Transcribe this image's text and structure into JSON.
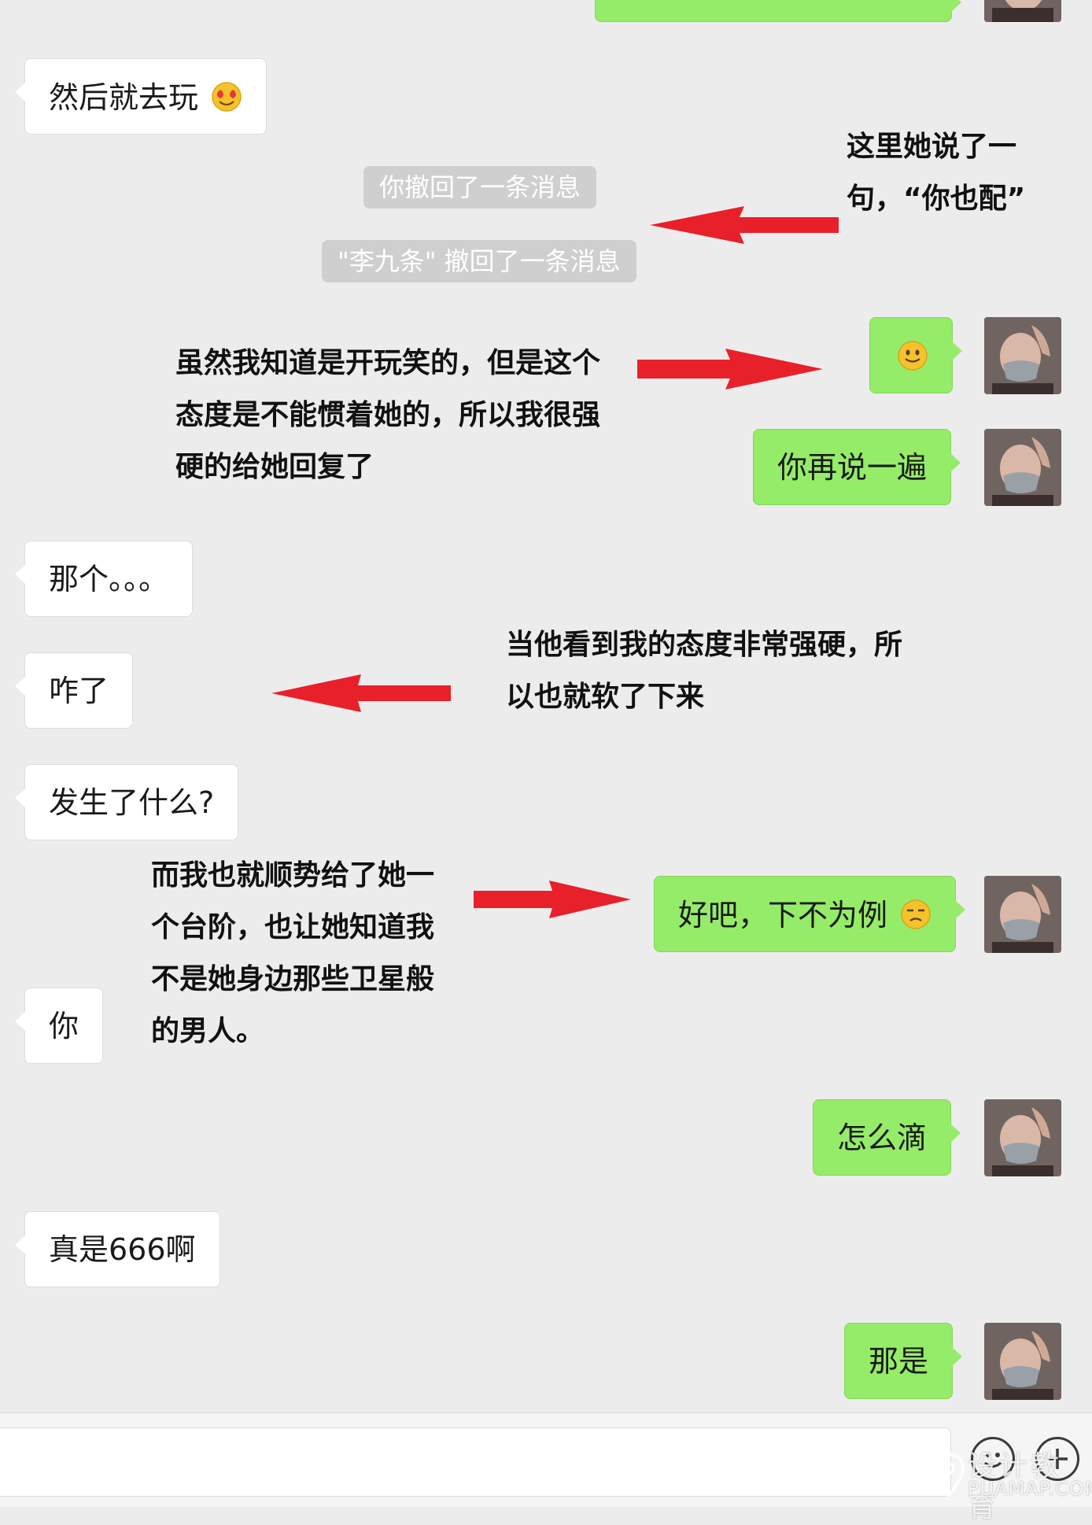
{
  "messages": {
    "out_top_partial": "",
    "in_1": "然后就去玩",
    "sys_1": "你撤回了一条消息",
    "sys_2": "\"李九条\" 撤回了一条消息",
    "out_1": "",
    "out_2": "你再说一遍",
    "in_2": "那个。。。",
    "in_3": "咋了",
    "in_4": "发生了什么?",
    "out_3": "好吧，下不为例",
    "in_5": "你",
    "out_4": "怎么滴",
    "in_6": "真是666啊",
    "out_5": "那是"
  },
  "notes": {
    "note_1": [
      "这里她说了一",
      "句，“你也配”"
    ],
    "note_2": [
      "虽然我知道是开玩笑的，但是这个",
      "态度是不能惯着她的，所以我很强",
      "硬的给她回复了"
    ],
    "note_3": [
      "当他看到我的态度非常强硬，所",
      "以也就软了下来"
    ],
    "note_4": [
      "而我也就顺势给了她一",
      "个台阶，也让她知道我",
      "不是她身边那些卫星般",
      "的男人。"
    ]
  },
  "watermark": {
    "name": "设计教育",
    "domain": "PUAMAP.COM"
  },
  "colors": {
    "background": "#ececec",
    "incoming_bubble": "#ffffff",
    "outgoing_bubble": "#95ec69",
    "system_tag": "#cfcfcf",
    "arrow": "#e8202a"
  },
  "icons": {
    "emoji_1": "heart-eyes-emoji-icon",
    "emoji_2": "smile-emoji-icon",
    "emoji_3": "unamused-emoji-icon",
    "voice_toggle": "emoji-face-icon",
    "plus": "plus-icon"
  }
}
